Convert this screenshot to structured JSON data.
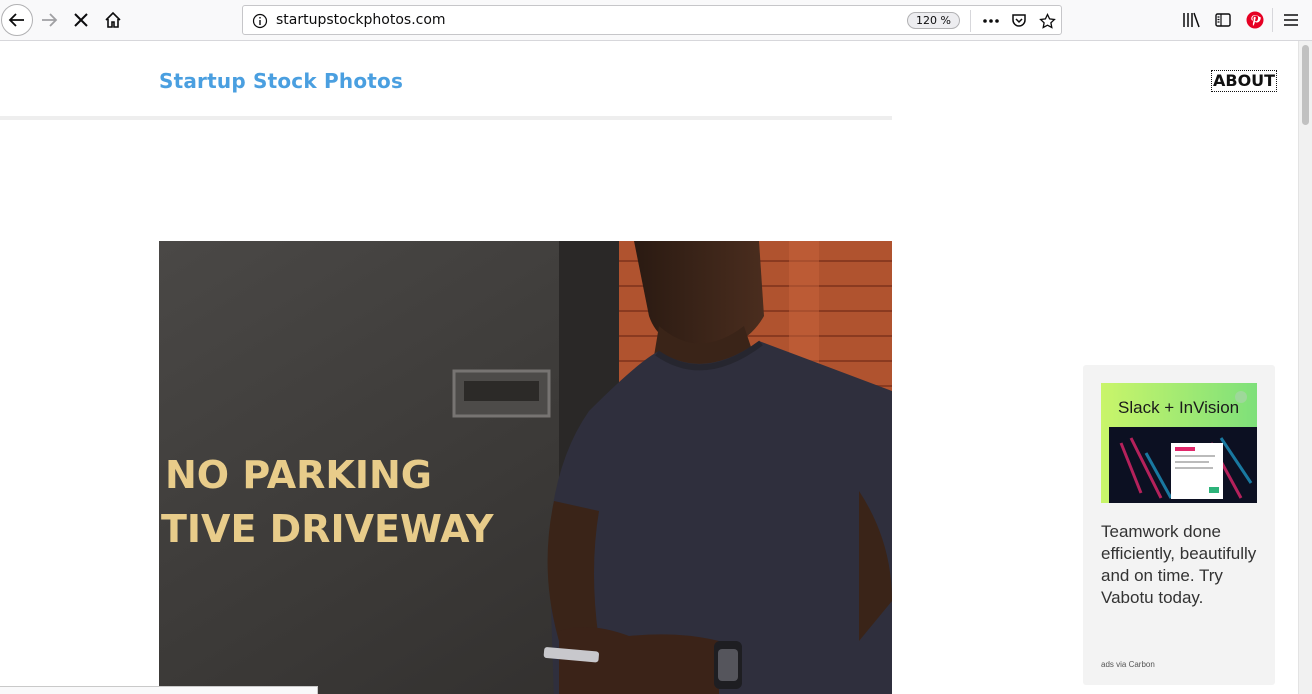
{
  "browser": {
    "url": "startupstockphotos.com",
    "zoom": "120 %",
    "icons": [
      "back-icon",
      "forward-icon",
      "stop-icon",
      "home-icon",
      "info-icon",
      "ellipsis-icon",
      "pocket-icon",
      "bookmark-star-icon",
      "library-icon",
      "sidebar-icon",
      "pinterest-icon",
      "menu-icon"
    ]
  },
  "site": {
    "title": "Startup Stock Photos",
    "nav": {
      "about": "ABOUT"
    }
  },
  "hero": {
    "sign_line1": "NO PARKING",
    "sign_line2": "TIVE DRIVEWAY"
  },
  "ad": {
    "image_title": "Slack + InVision",
    "text": "Teamwork done efficiently, beautifully and on time. Try Vabotu today.",
    "via": "ads via Carbon"
  },
  "colors": {
    "brand": "#4a9fe0",
    "ad_bg": "#f3f3f3",
    "pinterest": "#e60023"
  }
}
